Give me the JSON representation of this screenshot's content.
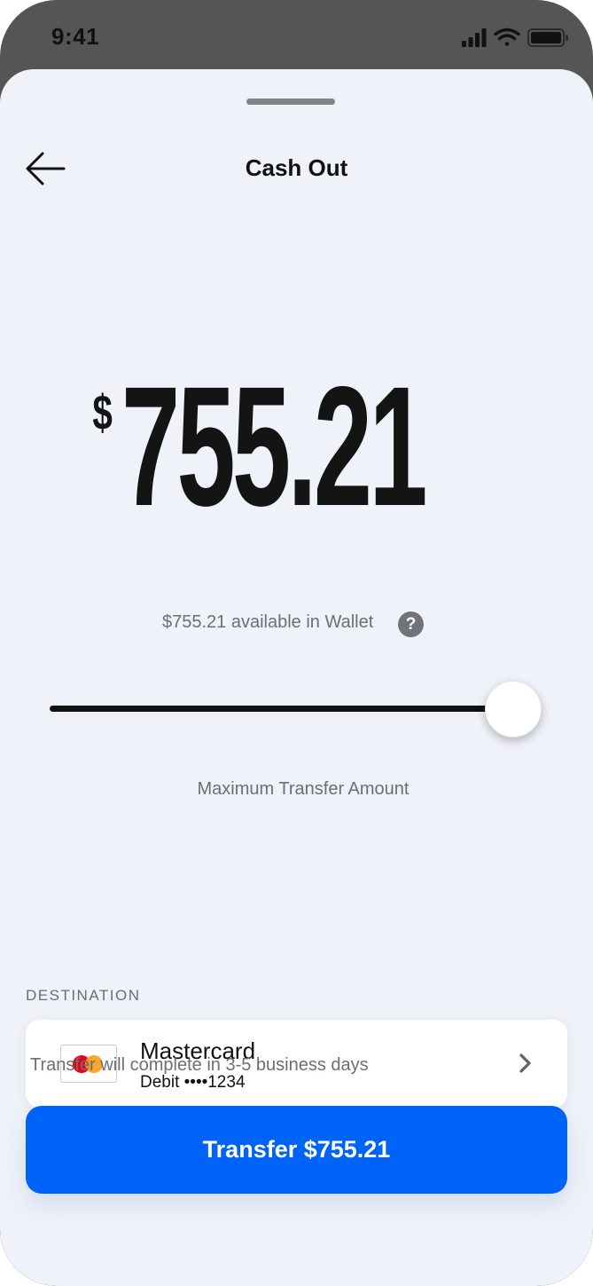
{
  "status_bar": {
    "time": "9:41",
    "icons": [
      "cellular-signal-icon",
      "wifi-icon",
      "battery-icon"
    ]
  },
  "header": {
    "title": "Cash Out",
    "back_icon": "arrow-left-icon"
  },
  "amount": {
    "currency_symbol": "$",
    "value": "755.21"
  },
  "wallet": {
    "available_text": "$755.21 available in Wallet",
    "help_glyph": "?"
  },
  "slider": {
    "level_fraction": 1.0,
    "caption": "Maximum Transfer Amount"
  },
  "destination": {
    "section_label": "DESTINATION",
    "card_name": "Mastercard",
    "card_detail": "Debit ••••1234",
    "logo_icon": "mastercard-logo-icon",
    "chevron_icon": "chevron-right-icon"
  },
  "transfer": {
    "note": "Transfer will complete in 3-5 business days",
    "button_label": "Transfer $755.21"
  },
  "colors": {
    "accent": "#0063f7",
    "sheet_background": "#eff2f8",
    "frame": "#555555",
    "mastercard_red": "#eb001b",
    "mastercard_orange": "#f79e1b"
  }
}
